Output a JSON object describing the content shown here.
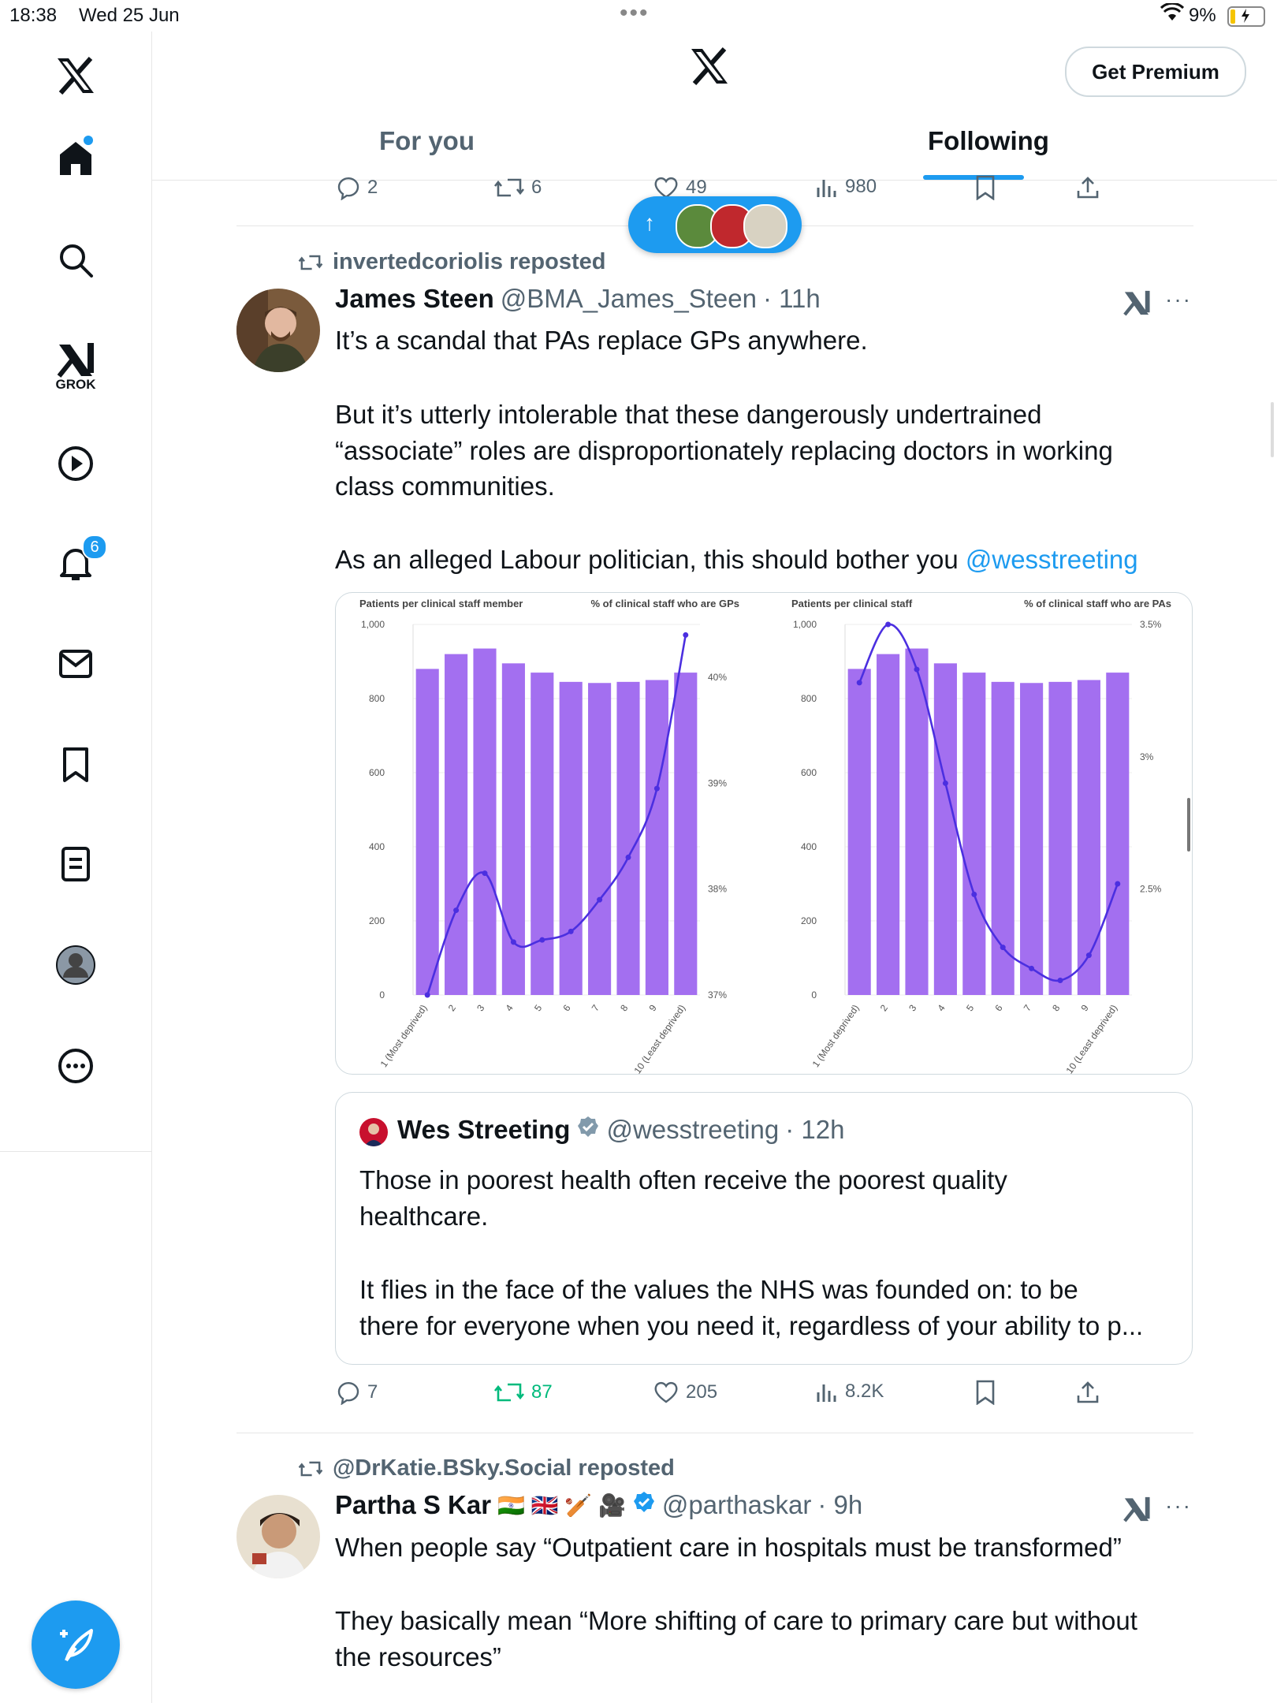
{
  "status_bar": {
    "time": "18:38",
    "date": "Wed 25 Jun",
    "battery": "9%"
  },
  "sidebar": {
    "grok_label": "GROK",
    "notifications_badge": "6"
  },
  "header": {
    "premium_label": "Get Premium",
    "tabs": [
      {
        "label": "For you"
      },
      {
        "label": "Following"
      }
    ],
    "active_tab": "Following"
  },
  "prev_post_actions": {
    "replies": "2",
    "reposts": "6",
    "likes": "49",
    "views": "980"
  },
  "new_posts_pill": {
    "arrow": "↑"
  },
  "post1": {
    "reposted_by": "invertedcoriolis reposted",
    "author_name": "James Steen",
    "handle": "@BMA_James_Steen",
    "time": "· 11h",
    "text_lines": [
      "It’s a scandal that PAs replace GPs anywhere.",
      "But it’s utterly intolerable that these dangerously undertrained",
      "“associate” roles are disproportionately replacing doctors in working",
      "class communities.",
      "As an alleged Labour politician, this should bother you "
    ],
    "mention": "@wesstreeting",
    "actions": {
      "replies": "7",
      "reposts": "87",
      "likes": "205",
      "views": "8.2K"
    },
    "quote": {
      "author_name": "Wes Streeting",
      "handle": "@wesstreeting",
      "time": "· 12h",
      "text_lines": [
        "Those in poorest health often receive the poorest quality",
        "healthcare.",
        "It flies in the face of the values the NHS was founded on: to be",
        "there for everyone when you need it, regardless of your ability to p..."
      ]
    }
  },
  "post2": {
    "reposted_by": "@DrKatie.BSky.Social reposted",
    "author_name": "Partha S Kar",
    "emojis": "🇮🇳 🇬🇧 🏏 🎥",
    "handle": "@parthaskar",
    "time": "· 9h",
    "text_lines": [
      "When people say “Outpatient care in hospitals must be transformed”",
      "They basically mean “More shifting of care to primary care but without",
      "the resources”"
    ]
  },
  "colors": {
    "accent": "#1d9bf0",
    "repost_green": "#00ba7c",
    "bar": "#a36ff0",
    "line": "#4b2fe0",
    "muted": "#536471"
  },
  "chart_data": [
    {
      "type": "bar",
      "title_left": "Patients per clinical staff member",
      "title_right": "% of clinical staff who are GPs",
      "categories": [
        "1 (Most deprived)",
        "2",
        "3",
        "4",
        "5",
        "6",
        "7",
        "8",
        "9",
        "10 (Least deprived)"
      ],
      "y_ticks": [
        "0",
        "200",
        "400",
        "600",
        "800",
        "1,000"
      ],
      "y2_ticks": [
        "37%",
        "38%",
        "39%",
        "40%"
      ],
      "ylim": [
        0,
        1000
      ],
      "y2lim": [
        37,
        40.5
      ],
      "series": [
        {
          "values": [
            880,
            920,
            935,
            895,
            870,
            845,
            842,
            845,
            850,
            870
          ]
        },
        {
          "values": [
            37.0,
            37.8,
            38.15,
            37.5,
            37.52,
            37.6,
            37.9,
            38.3,
            38.95,
            40.4
          ]
        }
      ]
    },
    {
      "type": "bar",
      "title_left": "Patients per clinical staff",
      "title_right": "% of clinical staff who are PAs",
      "categories": [
        "1 (Most deprived)",
        "2",
        "3",
        "4",
        "5",
        "6",
        "7",
        "8",
        "9",
        "10 (Least deprived)"
      ],
      "y_ticks": [
        "0",
        "200",
        "400",
        "600",
        "800",
        "1,000"
      ],
      "y2_ticks": [
        "2.5%",
        "3%",
        "3.5%"
      ],
      "ylim": [
        0,
        1000
      ],
      "y2lim": [
        2.1,
        3.5
      ],
      "series": [
        {
          "values": [
            880,
            920,
            935,
            895,
            870,
            845,
            842,
            845,
            850,
            870
          ]
        },
        {
          "values": [
            3.28,
            3.5,
            3.33,
            2.9,
            2.48,
            2.28,
            2.2,
            2.155,
            2.25,
            2.52
          ]
        }
      ]
    }
  ]
}
